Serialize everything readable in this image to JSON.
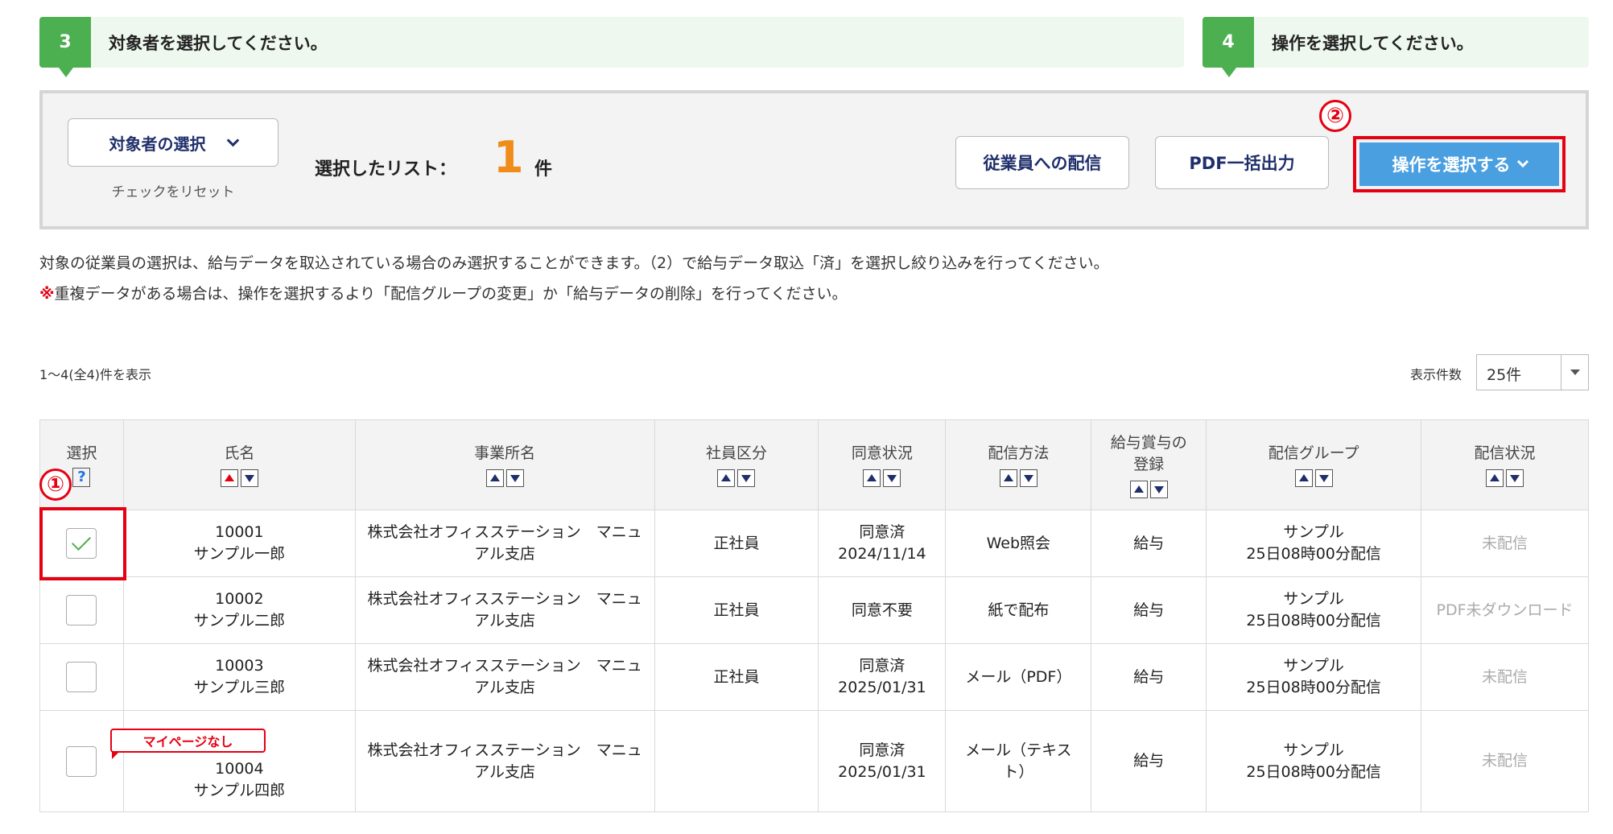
{
  "steps": [
    {
      "num": "3",
      "text": "対象者を選択してください。"
    },
    {
      "num": "4",
      "text": "操作を選択してください。"
    }
  ],
  "panel": {
    "select_label": "対象者の選択",
    "reset_label": "チェックをリセット",
    "list_label": "選択したリスト：",
    "list_count": "1",
    "list_unit": "件",
    "deliver_label": "従業員への配信",
    "pdf_label": "PDF一括出力",
    "operation_label": "操作を選択する"
  },
  "markers": {
    "one": "①",
    "two": "②"
  },
  "notes": {
    "line1": "対象の従業員の選択は、給与データを取込されている場合のみ選択することができます。（2）で給与データ取込「済」を選択し絞り込みを行ってください。",
    "line2_mark": "※",
    "line2": "重複データがある場合は、操作を選択するより「配信グループの変更」か「給与データの削除」を行ってください。"
  },
  "pager": {
    "range": "1～4(全4)件を表示",
    "perpage_label": "表示件数",
    "perpage_value": "25件"
  },
  "table": {
    "headers": [
      "選択",
      "氏名",
      "事業所名",
      "社員区分",
      "同意状況",
      "配信方法",
      "給与賞与の登録",
      "配信グループ",
      "配信状況"
    ],
    "help": "?",
    "header_line_a": "給与賞与の",
    "header_line_b": "登録",
    "rows": [
      {
        "checked": true,
        "id": "10001",
        "name": "サンプル一郎",
        "office1": "株式会社オフィスステーション　マニュ",
        "office2": "アル支店",
        "type": "正社員",
        "consent1": "同意済",
        "consent2": "2024/11/14",
        "method1": "Web照会",
        "method2": "",
        "reg": "給与",
        "group1": "サンプル",
        "group2": "25日08時00分配信",
        "status": "未配信"
      },
      {
        "checked": false,
        "id": "10002",
        "name": "サンプル二郎",
        "office1": "株式会社オフィスステーション　マニュ",
        "office2": "アル支店",
        "type": "正社員",
        "consent1": "同意不要",
        "consent2": "",
        "method1": "紙で配布",
        "method2": "",
        "reg": "給与",
        "group1": "サンプル",
        "group2": "25日08時00分配信",
        "status": "PDF未ダウンロード"
      },
      {
        "checked": false,
        "id": "10003",
        "name": "サンプル三郎",
        "office1": "株式会社オフィスステーション　マニュ",
        "office2": "アル支店",
        "type": "正社員",
        "consent1": "同意済",
        "consent2": "2025/01/31",
        "method1": "メール（PDF）",
        "method2": "",
        "reg": "給与",
        "group1": "サンプル",
        "group2": "25日08時00分配信",
        "status": "未配信"
      },
      {
        "checked": false,
        "id": "10004",
        "name": "サンプル四郎",
        "office1": "株式会社オフィスステーション　マニュ",
        "office2": "アル支店",
        "type": "",
        "consent1": "同意済",
        "consent2": "2025/01/31",
        "method1": "メール（テキス",
        "method2": "ト）",
        "reg": "給与",
        "group1": "サンプル",
        "group2": "25日08時00分配信",
        "status": "未配信"
      }
    ],
    "badge": "マイページなし"
  },
  "colors": {
    "step_green": "#4caf50",
    "highlight_red": "#e50012",
    "primary_blue": "#4a9fe0",
    "count_orange": "#f08c1a"
  }
}
